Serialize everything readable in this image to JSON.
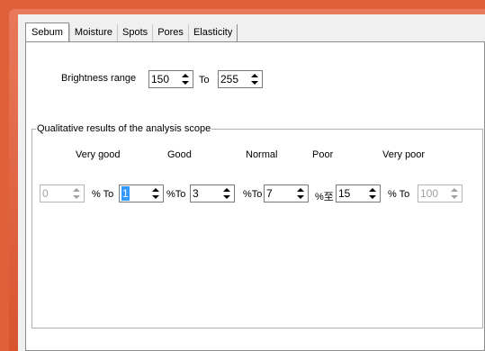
{
  "tabs": [
    {
      "label": "Sebum"
    },
    {
      "label": "Moisture"
    },
    {
      "label": "Spots"
    },
    {
      "label": "Pores"
    },
    {
      "label": "Elasticity"
    }
  ],
  "brightness": {
    "label": "Brightness range",
    "min_value": "150",
    "to_label": "To",
    "max_value": "255"
  },
  "qualitative": {
    "title": "Qualitative results of the analysis scope",
    "headers": [
      "Very good",
      "Good",
      "Normal",
      "Poor",
      "Very poor"
    ],
    "values": [
      "0",
      "1",
      "3",
      "7",
      "15",
      "100"
    ],
    "units": [
      "% To",
      "%To",
      "%To",
      "%至",
      "% To"
    ]
  }
}
